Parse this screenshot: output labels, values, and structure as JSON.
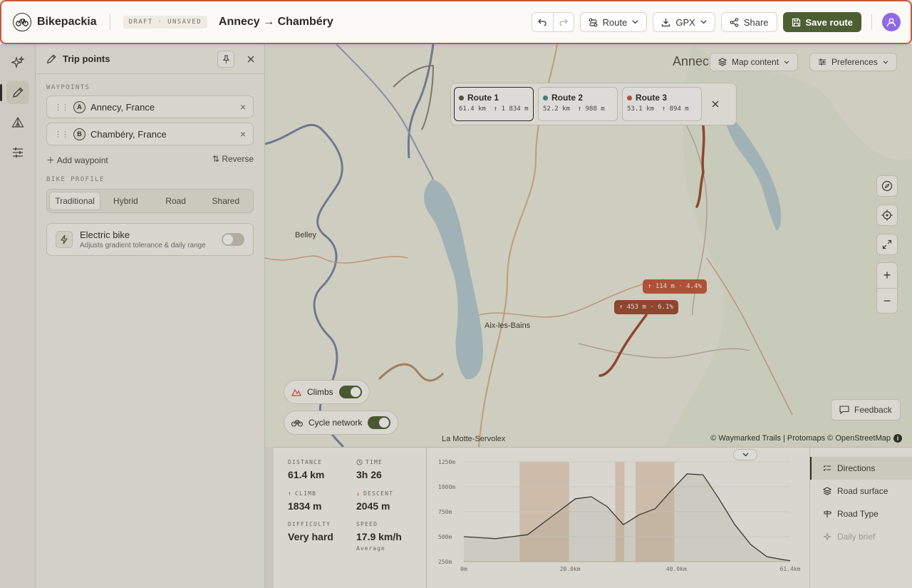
{
  "header": {
    "brand": "Bikepackia",
    "status_badge": "DRAFT · UNSAVED",
    "trip_title": "Annecy → Chambéry",
    "route_button": "Route",
    "gpx_button": "GPX",
    "share_button": "Share",
    "save_button": "Save route"
  },
  "panel": {
    "title": "Trip points",
    "waypoints_label": "WAYPOINTS",
    "waypoints": [
      {
        "marker": "A",
        "name": "Annecy, France"
      },
      {
        "marker": "B",
        "name": "Chambéry, France"
      }
    ],
    "add_waypoint": "Add waypoint",
    "reverse": "Reverse",
    "bike_profile_label": "BIKE PROFILE",
    "profiles": [
      "Traditional",
      "Hybrid",
      "Road",
      "Shared"
    ],
    "selected_profile": "Traditional",
    "ebike_title": "Electric bike",
    "ebike_desc": "Adjusts gradient tolerance & daily range",
    "ebike_enabled": false
  },
  "map": {
    "map_content_button": "Map content",
    "preferences_button": "Preferences",
    "places": [
      "Annec",
      "Belley",
      "Aix-les-Bains",
      "La Motte-Servolex"
    ],
    "route_options": [
      {
        "name": "Route 1",
        "distance": "61.4 km",
        "climb": "↑ 1 834 m",
        "color": "#4d5e33",
        "selected": true
      },
      {
        "name": "Route 2",
        "distance": "52.2 km",
        "climb": "↑ 988 m",
        "color": "#4c8c93",
        "selected": false
      },
      {
        "name": "Route 3",
        "distance": "53.1 km",
        "climb": "↑ 894 m",
        "color": "#c8573a",
        "selected": false
      }
    ],
    "climb_chips": [
      "↑ 114 m · 4.4%",
      "↑ 453 m · 6.1%"
    ],
    "climbs_toggle": "Climbs",
    "cycle_network_toggle": "Cycle network",
    "feedback_button": "Feedback",
    "attribution": "© Waymarked Trails | Protomaps © OpenStreetMap"
  },
  "stats": {
    "distance_label": "DISTANCE",
    "distance": "61.4 km",
    "time_label": "TIME",
    "time": "3h 26",
    "climb_label": "CLIMB",
    "climb": "1834 m",
    "descent_label": "DESCENT",
    "descent": "2045 m",
    "difficulty_label": "DIFFICULTY",
    "difficulty": "Very hard",
    "speed_label": "SPEED",
    "speed": "17.9 km/h",
    "speed_note": "Average"
  },
  "tabs": [
    "Directions",
    "Road surface",
    "Road Type",
    "Daily brief"
  ],
  "chart_data": {
    "type": "area",
    "x": [
      0,
      3,
      6,
      9,
      12,
      15,
      18,
      21,
      24,
      27,
      30,
      33,
      36,
      39,
      42,
      45,
      48,
      51,
      54,
      57,
      60,
      61.4
    ],
    "values": [
      500,
      490,
      480,
      500,
      520,
      640,
      760,
      880,
      900,
      800,
      620,
      720,
      780,
      960,
      1130,
      1120,
      880,
      620,
      420,
      300,
      270,
      260
    ],
    "y_ticks": [
      "1250m",
      "1000m",
      "750m",
      "500m",
      "250m"
    ],
    "x_ticks": [
      "0m",
      "20.0km",
      "40.0km",
      "61.4km"
    ],
    "ylim": [
      250,
      1250
    ],
    "xlim": [
      0,
      61.4
    ],
    "climb_ranges": [
      [
        10.5,
        19.8
      ],
      [
        28.5,
        30.2
      ],
      [
        32.3,
        39.6
      ]
    ]
  }
}
